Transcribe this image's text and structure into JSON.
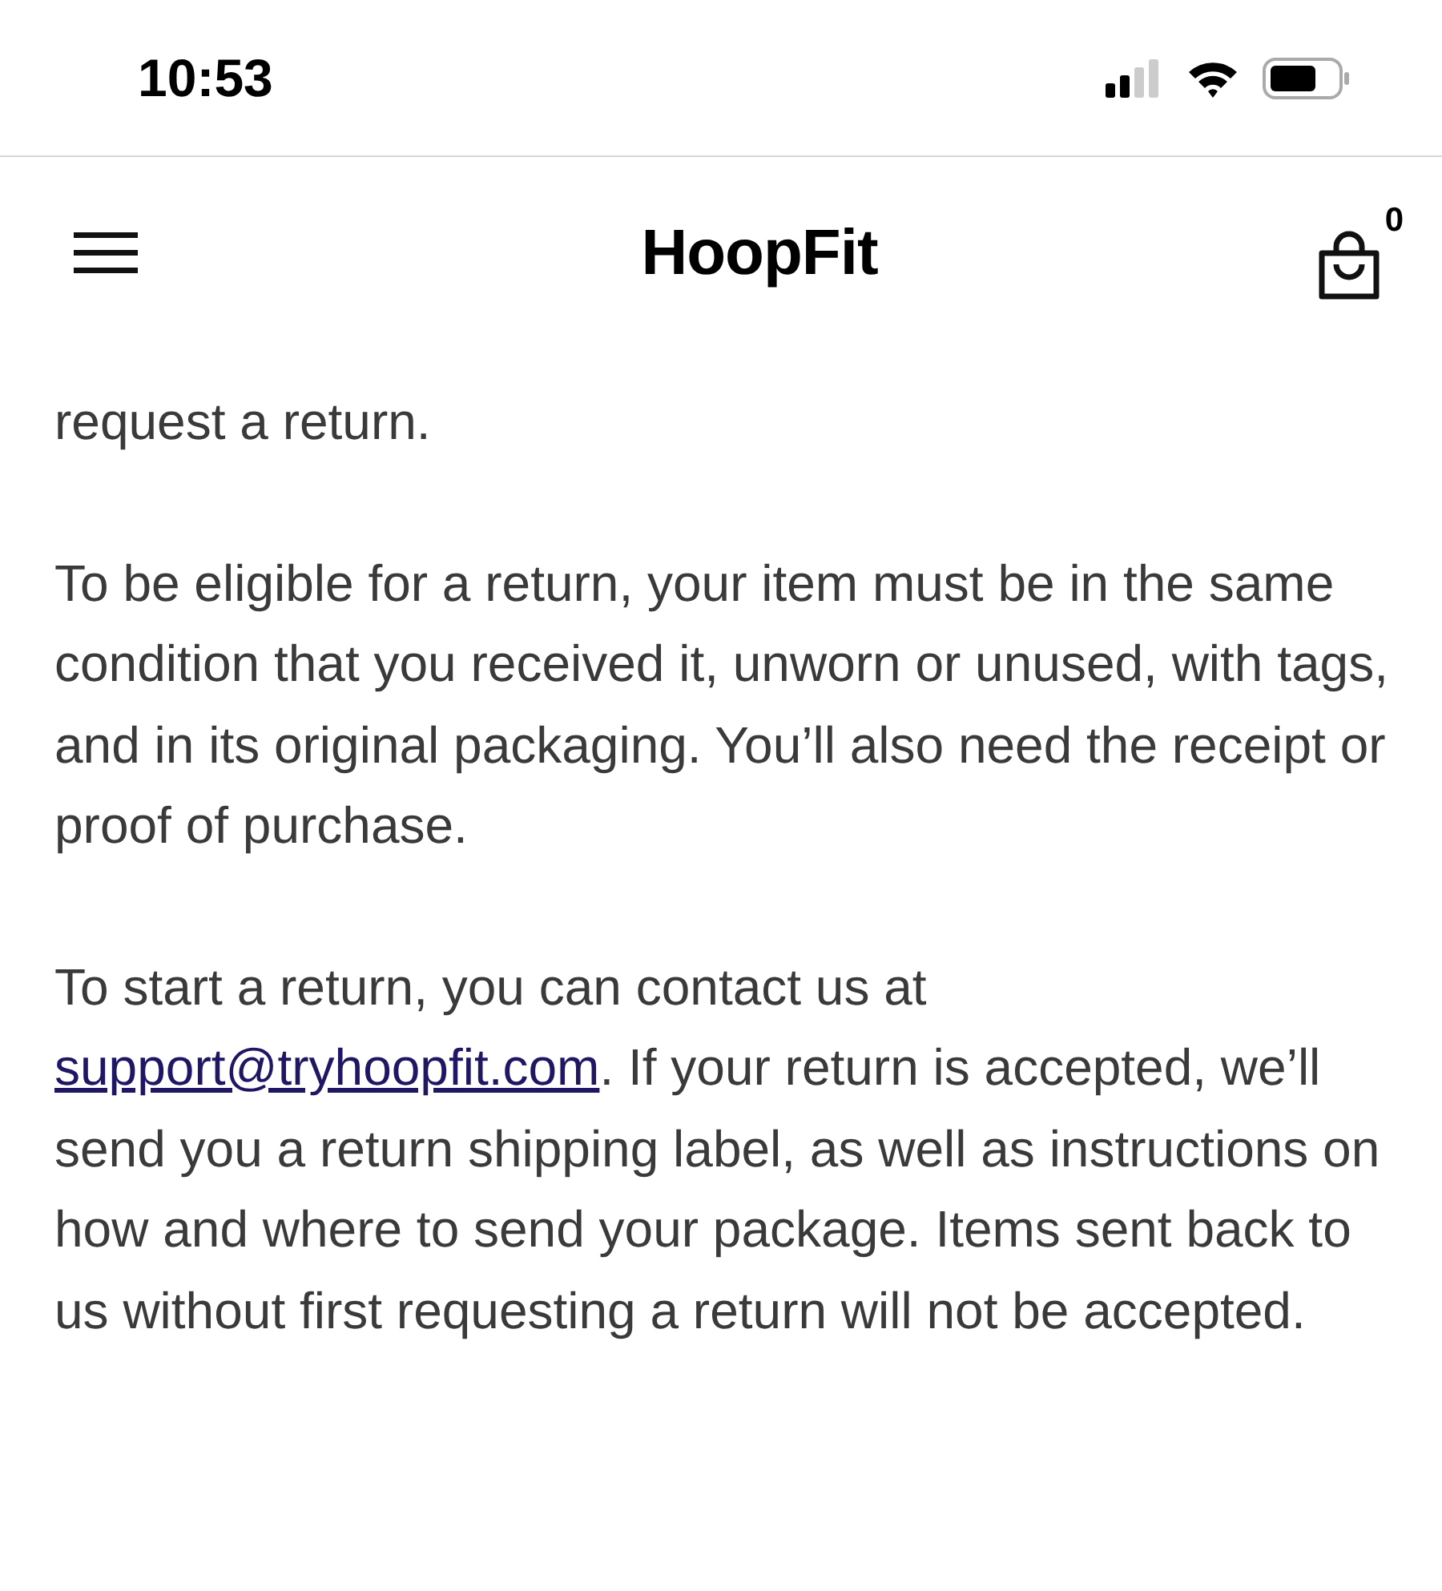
{
  "status_bar": {
    "time": "10:53"
  },
  "header": {
    "logo": "HoopFit",
    "cart_count": "0"
  },
  "paragraphs": [
    {
      "text": "request a return."
    },
    {
      "text": "To be eligible for a return, your item must be in the same condition that you received it, unworn or unused, with tags, and in its original packaging. You’ll also need the receipt or proof of purchase."
    },
    {
      "text": "To start a return, you can contact us at ",
      "link": "support@tryhoopfit.com",
      "text_after": ". If your return is accepted, we’ll send you a return shipping label, as well as instructions on how and where to send your package. Items sent back to us without first requesting a return will not be accepted."
    }
  ]
}
